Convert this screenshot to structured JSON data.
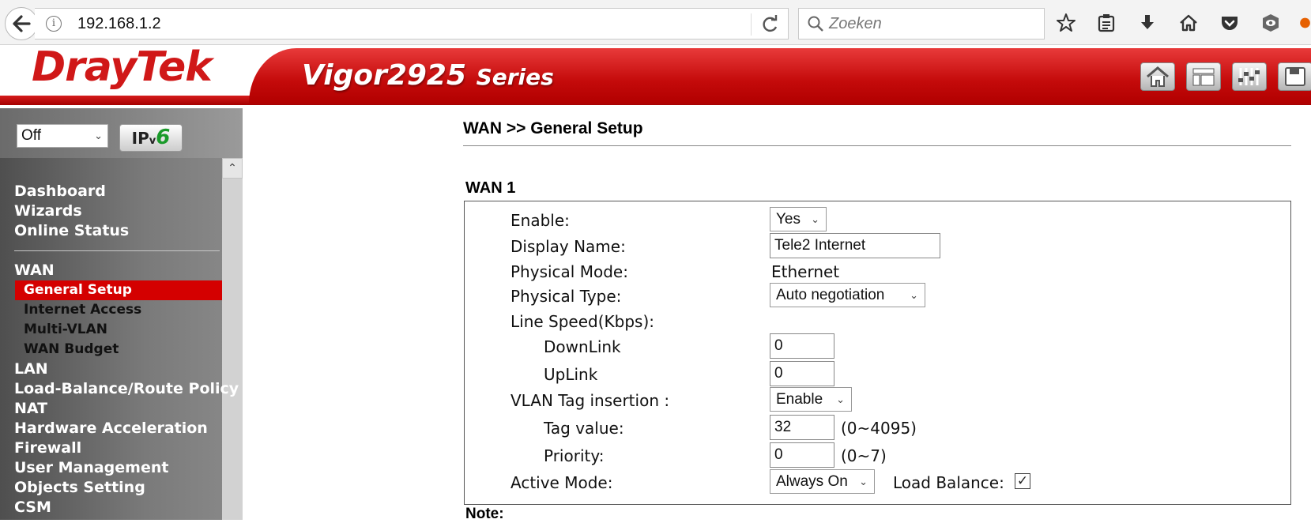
{
  "browser": {
    "url": "192.168.1.2",
    "search_placeholder": "Zoeken"
  },
  "header": {
    "brand": "DrayTek",
    "model": "Vigor2925",
    "series": "Series"
  },
  "sidebar": {
    "ip_mode_value": "Off",
    "ipv6_button_label": "IPv6",
    "items": [
      "Dashboard",
      "Wizards",
      "Online Status",
      "WAN",
      "General Setup",
      "Internet Access",
      "Multi-VLAN",
      "WAN Budget",
      "LAN",
      "Load-Balance/Route Policy",
      "NAT",
      "Hardware Acceleration",
      "Firewall",
      "User Management",
      "Objects Setting",
      "CSM"
    ]
  },
  "main": {
    "page_title": "WAN >> General Setup",
    "section_title": "WAN 1",
    "fields": {
      "enable_label": "Enable:",
      "enable_value": "Yes",
      "display_name_label": "Display Name:",
      "display_name_value": "Tele2 Internet",
      "physical_mode_label": "Physical Mode:",
      "physical_mode_value": "Ethernet",
      "physical_type_label": "Physical Type:",
      "physical_type_value": "Auto negotiation",
      "line_speed_label": "Line Speed(Kbps):",
      "downlink_label": "DownLink",
      "downlink_value": "0",
      "uplink_label": "UpLink",
      "uplink_value": "0",
      "vlan_tag_label": "VLAN Tag insertion :",
      "vlan_tag_value": "Enable",
      "tag_value_label": "Tag value:",
      "tag_value_value": "32",
      "tag_value_range": "(0~4095)",
      "priority_label": "Priority:",
      "priority_value": "0",
      "priority_range": "(0~7)",
      "active_mode_label": "Active Mode:",
      "active_mode_value": "Always On",
      "load_balance_label": "Load Balance:",
      "load_balance_checked": true
    },
    "note_label": "Note:"
  },
  "colors": {
    "brand_red": "#d40000",
    "sidebar_gray": "#7a7a7a",
    "ipv6_green": "#1a9a2a"
  }
}
